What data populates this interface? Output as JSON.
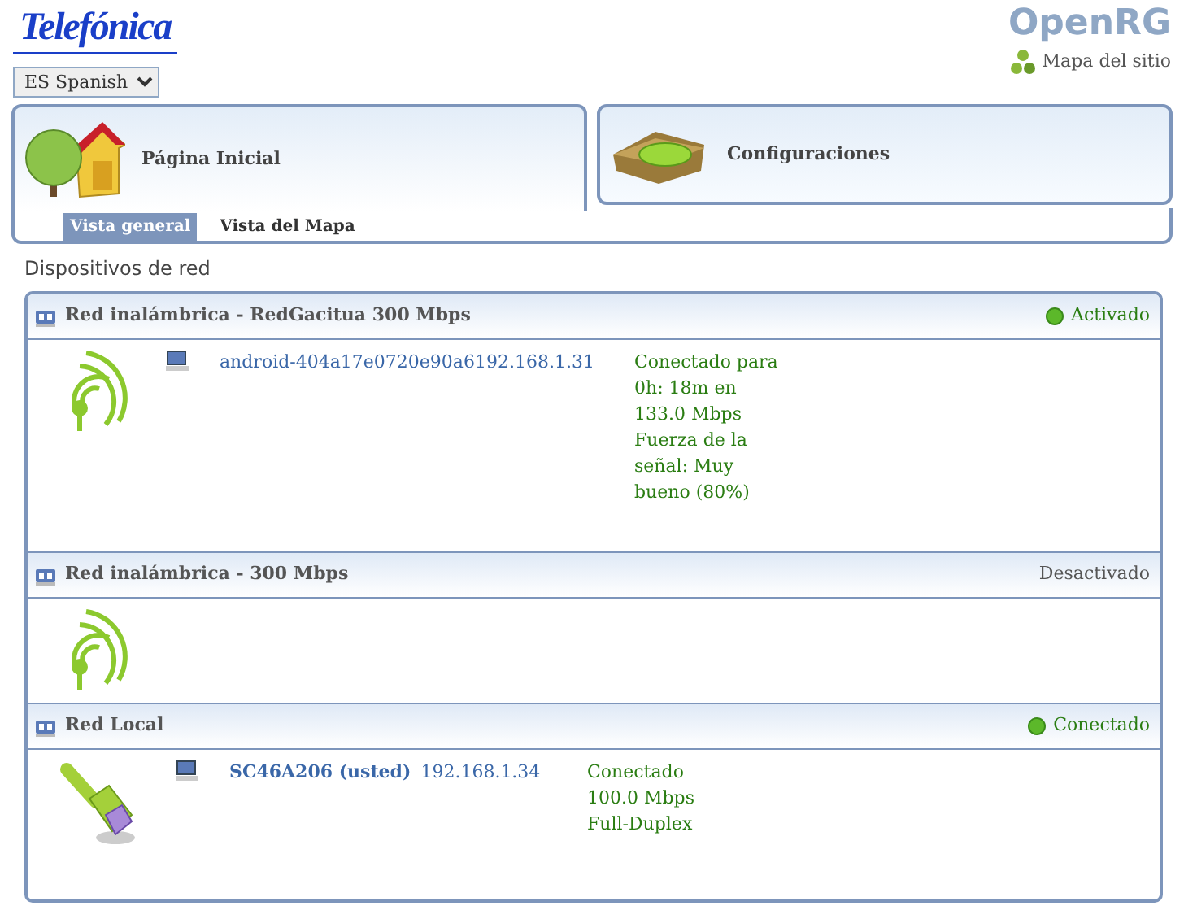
{
  "header": {
    "brand": "Telefónica",
    "product": "OpenRG",
    "language": "ES Spanish",
    "sitemap_link": "Mapa del sitio"
  },
  "main_tabs": [
    {
      "label": "Página Inicial",
      "kind": "home",
      "selected": true
    },
    {
      "label": "Configuraciones",
      "kind": "settings",
      "selected": false
    }
  ],
  "sub_tabs": [
    {
      "label": "Vista general",
      "selected": true
    },
    {
      "label": "Vista del Mapa",
      "selected": false
    }
  ],
  "page_title": "Dispositivos de red",
  "networks": [
    {
      "title": "Red inalámbrica - RedGacitua 300 Mbps",
      "kind": "wireless",
      "status": "Activado",
      "active": true,
      "devices": [
        {
          "name": "android-404a17e0720e90a6192.168.1.31",
          "current": false,
          "status_lines": [
            "Conectado para",
            "0h: 18m en",
            "133.0 Mbps",
            "Fuerza de la",
            "señal: Muy",
            "bueno (80%)"
          ]
        }
      ]
    },
    {
      "title": "Red inalámbrica - 300 Mbps",
      "kind": "wireless",
      "status": "Desactivado",
      "active": false
    },
    {
      "title": "Red Local",
      "kind": "lan",
      "status": "Conectado",
      "active": true,
      "devices": [
        {
          "name": "SC46A206 (usted)",
          "current": true,
          "ip": "192.168.1.34",
          "status_lines": [
            "Conectado",
            "100.0 Mbps",
            "Full-Duplex"
          ]
        }
      ]
    }
  ]
}
